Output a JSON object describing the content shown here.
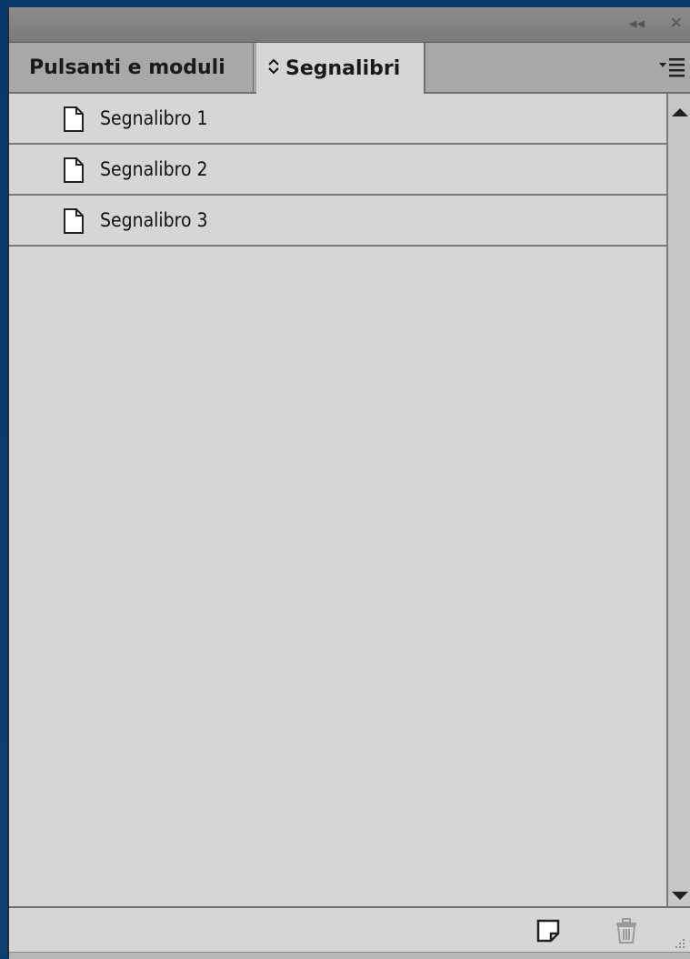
{
  "panel": {
    "controls": {
      "collapse_icon": "double-chevron-left-icon",
      "close_icon": "close-icon",
      "collapse_glyph": "◂◂",
      "close_glyph": "✕"
    },
    "tabs": [
      {
        "label": "Pulsanti e moduli",
        "active": false
      },
      {
        "label": "Segnalibri",
        "active": true,
        "icon": "up-down-arrows-icon"
      }
    ],
    "menu_icon": "panel-menu-icon"
  },
  "bookmarks": [
    {
      "label": "Segnalibro 1",
      "icon": "document-icon"
    },
    {
      "label": "Segnalibro 2",
      "icon": "document-icon"
    },
    {
      "label": "Segnalibro 3",
      "icon": "document-icon"
    }
  ],
  "footer": {
    "new_icon": "new-bookmark-icon",
    "delete_icon": "trash-icon"
  },
  "colors": {
    "panel_bg": "#d6d6d6",
    "tab_inactive_bg": "#a8a8a8",
    "background": "#0b3a6e"
  }
}
